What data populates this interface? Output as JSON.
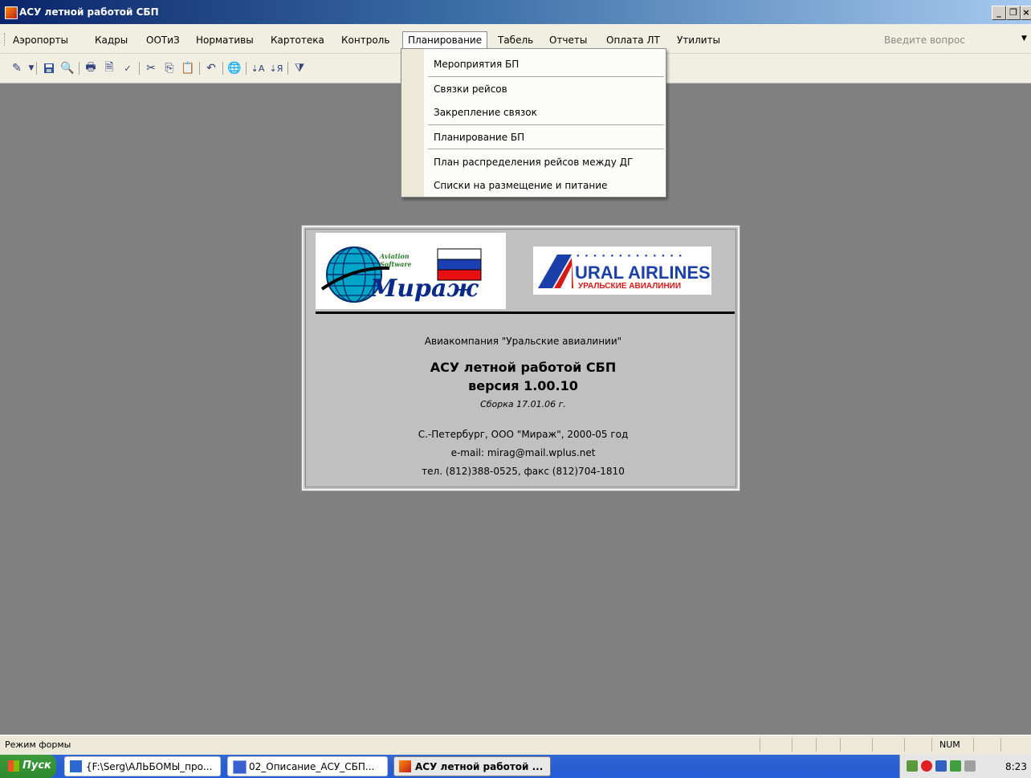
{
  "window": {
    "title": "АСУ летной работой СБП"
  },
  "menubar": {
    "items": [
      "Аэропорты",
      "Кадры",
      "ООТиЗ",
      "Нормативы",
      "Картотека",
      "Контроль",
      "Планирование",
      "Табель",
      "Отчеты",
      "Оплата ЛТ",
      "Утилиты"
    ],
    "active": "Планирование",
    "question_placeholder": "Введите вопрос"
  },
  "toolbar": {
    "icons": [
      "design-view-icon",
      "dropdown-arrow-icon",
      "save-icon",
      "search-database-icon",
      "print-icon",
      "print-preview-icon",
      "spelling-icon",
      "cut-icon",
      "copy-icon",
      "paste-icon",
      "undo-icon",
      "hyperlink-icon",
      "sort-ascending-icon",
      "sort-descending-icon",
      "filter-icon"
    ]
  },
  "dropdown": {
    "items": [
      "Мероприятия БП",
      "Связки рейсов",
      "Закрепление связок",
      "Планирование БП",
      "План распределения рейсов между ДГ",
      "Списки на размещение и питание"
    ]
  },
  "splash": {
    "logo_left": {
      "word": "Мираж",
      "line1": "Aviation",
      "line2": "Software"
    },
    "logo_right": {
      "name": "URAL AIRLINES",
      "subname": "УРАЛЬСКИЕ АВИАЛИНИИ"
    },
    "airline": "Авиакомпания  \"Уральские авиалинии\"",
    "title": "АСУ летной работой СБП",
    "version": "версия 1.00.10",
    "build": "Сборка 17.01.06 г.",
    "copyright": "С.-Петербург, ООО \"Мираж\", 2000-05 год",
    "email": "e-mail: mirag@mail.wplus.net",
    "phone": "тел. (812)388-0525, факс (812)704-1810"
  },
  "statusbar": {
    "mode": "Режим формы",
    "num": "NUM"
  },
  "taskbar": {
    "start": "Пуск",
    "tasks": [
      "{F:\\Serg\\АЛЬБОМЫ_про...",
      "02_Описание_АСУ_СБП...",
      "АСУ летной работой ..."
    ],
    "clock": "8:23"
  }
}
